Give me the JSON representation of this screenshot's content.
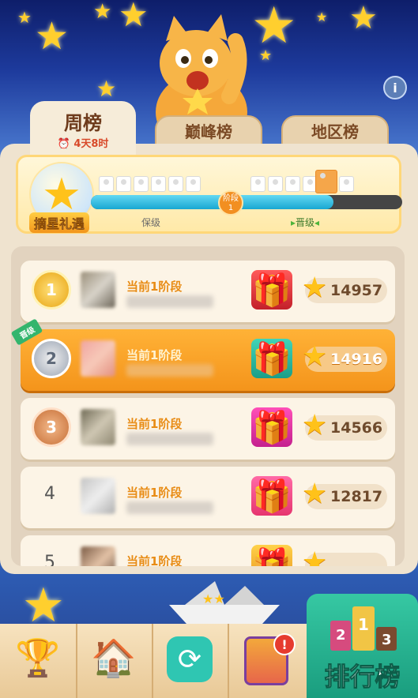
{
  "tabs": [
    {
      "label": "周榜",
      "sublabel": "4天8时",
      "active": true
    },
    {
      "label": "巅峰榜",
      "active": false
    },
    {
      "label": "地区榜",
      "active": false
    }
  ],
  "reward": {
    "title": "摘星礼遇",
    "stage_label": "阶段",
    "stage_number": "1",
    "relegation_label": "保级",
    "promotion_label": "晋级",
    "progress": 0.78
  },
  "info_icon": "i",
  "promote_tag": "晋级",
  "leaderboard": [
    {
      "rank": "1",
      "medal": "gold",
      "stage": "当前1阶段",
      "score": "14957",
      "gift": "red-gift",
      "highlighted": false
    },
    {
      "rank": "2",
      "medal": "silver",
      "stage": "当前1阶段",
      "score": "14916",
      "gift": "teal-gift",
      "highlighted": true
    },
    {
      "rank": "3",
      "medal": "bronze",
      "stage": "当前1阶段",
      "score": "14566",
      "gift": "pink-gift",
      "highlighted": false
    },
    {
      "rank": "4",
      "medal": "none",
      "stage": "当前1阶段",
      "score": "12817",
      "gift": "pink-gold-gift",
      "highlighted": false
    },
    {
      "rank": "5",
      "medal": "none",
      "stage": "当前1阶段",
      "score": "",
      "gift": "gold-gift",
      "highlighted": false
    }
  ],
  "nav": {
    "items": [
      {
        "icon": "trophy-icon"
      },
      {
        "icon": "home-renovate-icon"
      },
      {
        "icon": "refresh-icon"
      },
      {
        "icon": "cards-icon",
        "badge": "!"
      }
    ],
    "active_label": "排行榜",
    "podium": [
      "2",
      "1",
      "3"
    ]
  },
  "colors": {
    "accent_orange": "#f4941b",
    "tab_active": "#f6ecd9",
    "nav_active": "#1a9d7e"
  }
}
